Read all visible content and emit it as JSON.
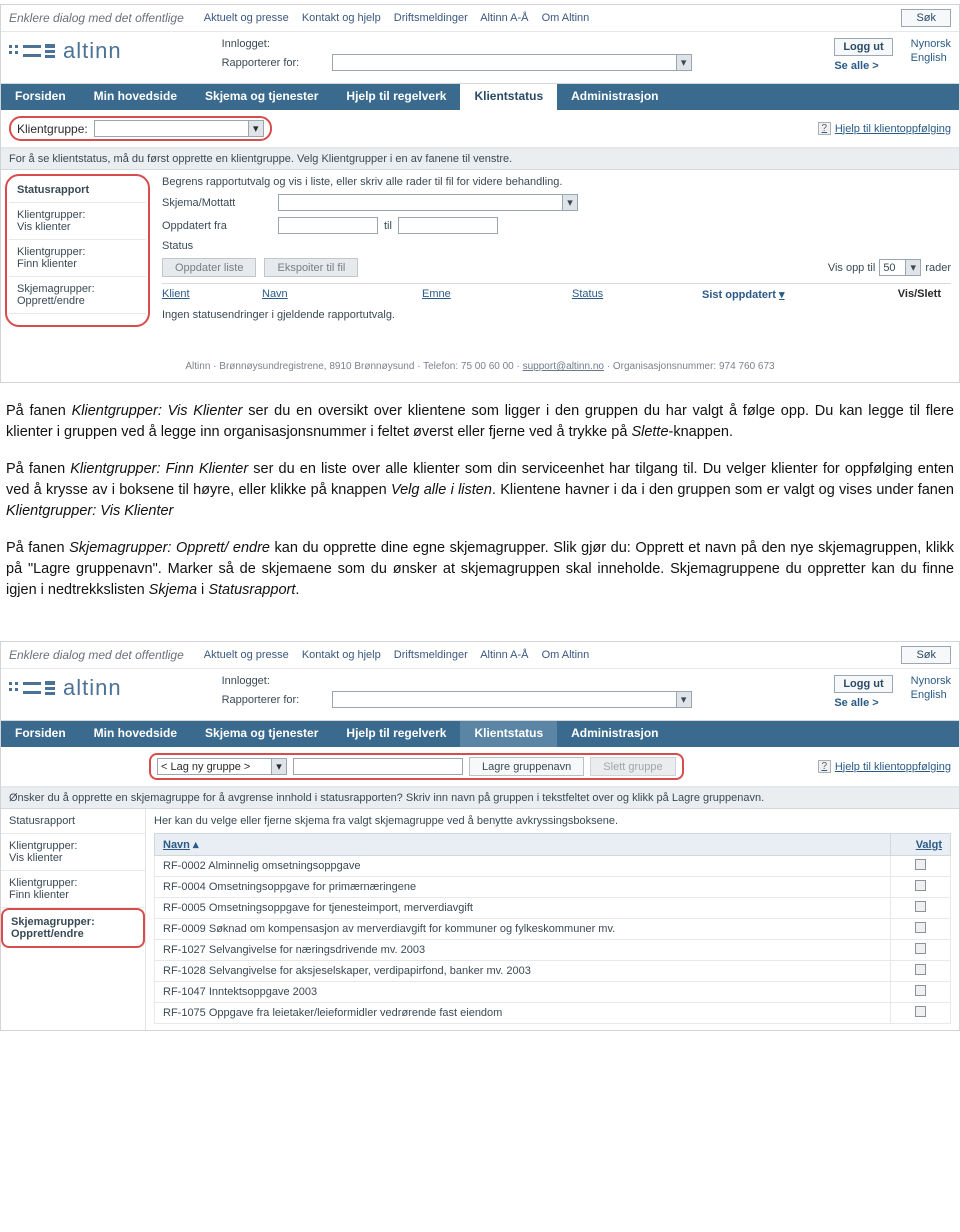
{
  "header": {
    "slogan": "Enklere dialog med det offentlige",
    "nav": [
      "Aktuelt og presse",
      "Kontakt og hjelp",
      "Driftsmeldinger",
      "Altinn A-Å",
      "Om Altinn"
    ],
    "search": "Søk",
    "brand": "altinn",
    "logged_in": "Innlogget:",
    "reporting_for": "Rapporterer for:",
    "logout": "Logg ut",
    "see_all": "Se alle >",
    "lang": [
      "Nynorsk",
      "English"
    ]
  },
  "tabs": [
    "Forsiden",
    "Min hovedside",
    "Skjema og tjenester",
    "Hjelp til regelverk",
    "Klientstatus",
    "Administrasjon"
  ],
  "shot1": {
    "group_label": "Klientgruppe:",
    "help_link": "Hjelp til klientoppfølging",
    "hint": "For å se klientstatus, må du først opprette en klientgruppe. Velg Klientgrupper i en av fanene til venstre.",
    "side": [
      "Statusrapport",
      "Klientgrupper:",
      "Vis klienter",
      "Klientgrupper:",
      "Finn klienter",
      "Skjemagrupper:",
      "Opprett/endre"
    ],
    "intro": "Begrens rapportutvalg og vis i liste, eller skriv alle rader til fil for videre behandling.",
    "skjema": "Skjema/Mottatt",
    "oppdatert": "Oppdatert fra",
    "til": "til",
    "status": "Status",
    "btn_update": "Oppdater liste",
    "btn_export": "Ekspoiter til fil",
    "rows_pref": "Vis opp til",
    "rows_val": "50",
    "rows_suff": "rader",
    "cols": [
      "Klient",
      "Navn",
      "Emne",
      "Status",
      "Sist oppdatert",
      "Vis/Slett"
    ],
    "empty": "Ingen statusendringer i gjeldende rapportutvalg."
  },
  "footer": {
    "text_a": "Altinn · Brønnøysundregistrene, 8910 Brønnøysund · Telefon: 75 00 60 00 · ",
    "mail": "support@altinn.no",
    "text_b": " · Organisasjonsnummer: 974 760 673"
  },
  "doc": {
    "p1": "På fanen Klientgrupper: Vis Klienter ser du en oversikt over klientene som ligger i den gruppen du har valgt å følge opp. Du kan legge til flere klienter i gruppen ved å legge inn organisasjonsnummer i feltet øverst eller fjerne ved å trykke på Slette-knappen.",
    "p2": "På fanen Klientgrupper: Finn Klienter ser du en liste over alle klienter som din serviceenhet har tilgang til. Du velger klienter for oppfølging enten ved å krysse av i boksene til høyre, eller klikke på knappen Velg alle i listen. Klientene havner i da i den gruppen som er valgt og vises under fanen Klientgrupper: Vis Klienter",
    "p3": "På fanen Skjemagrupper: Opprett/ endre kan du opprette dine egne skjemagrupper. Slik gjør du: Opprett et navn på den nye skjemagruppen, klikk på \"Lagre gruppenavn\". Marker så de skjemaene som du ønsker at skjemagruppen skal inneholde. Skjemagruppene du oppretter kan du finne igjen i nedtrekkslisten Skjema i Statusrapport."
  },
  "shot2": {
    "new_group": "< Lag ny gruppe >",
    "btn_save": "Lagre gruppenavn",
    "btn_del": "Slett gruppe",
    "hint": "Ønsker du å opprette en skjemagruppe for å avgrense innhold i statusrapporten? Skriv inn navn på gruppen i tekstfeltet over og klikk på Lagre gruppenavn.",
    "intro": "Her kan du velge eller fjerne skjema fra valgt skjemagruppe ved å benytte avkryssingsboksene.",
    "col_name": "Navn",
    "col_sel": "Valgt",
    "rows": [
      "RF-0002 Alminnelig omsetningsoppgave",
      "RF-0004 Omsetningsoppgave for primærnæringene",
      "RF-0005 Omsetningsoppgave for tjenesteimport, merverdiavgift",
      "RF-0009 Søknad om kompensasjon av merverdiavgift for kommuner og fylkeskommuner mv.",
      "RF-1027 Selvangivelse for næringsdrivende mv. 2003",
      "RF-1028 Selvangivelse for aksjeselskaper, verdipapirfond, banker mv. 2003",
      "RF-1047 Inntektsoppgave 2003",
      "RF-1075 Oppgave fra leietaker/leieformidler vedrørende fast eiendom"
    ]
  }
}
